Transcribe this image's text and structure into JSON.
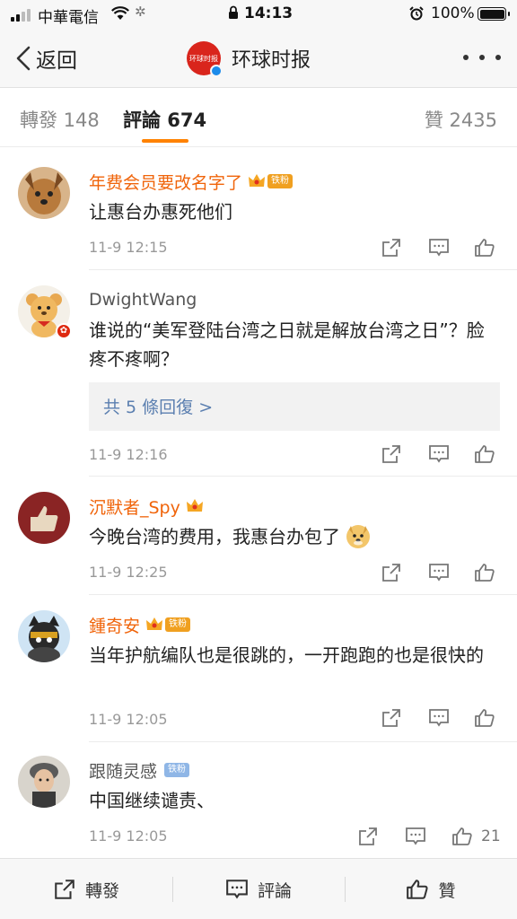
{
  "status_bar": {
    "carrier": "中華電信",
    "time": "14:13",
    "battery": "100%",
    "battery_level": 1.0
  },
  "nav": {
    "back_label": "返回",
    "title": "环球时报",
    "logo_text": "环球时报"
  },
  "tabs": {
    "repost": "轉發 148",
    "comment": "評論 674",
    "like": "贊 2435",
    "active": "comment"
  },
  "colors": {
    "accent": "#ff8200",
    "vip_name": "#f0640a",
    "link": "#5b7fb0"
  },
  "comments": [
    {
      "name": "年费会员要改名字了",
      "badge": "铁粉",
      "vip": true,
      "text": "让惠台办惠死他们",
      "time": "11-9 12:15"
    },
    {
      "name": "DwightWang",
      "text": "谁说的“美军登陆台湾之日就是解放台湾之日”？脸疼不疼啊？",
      "replies": "共 5 條回復 >",
      "time": "11-9 12:16"
    },
    {
      "name": "沉默者_Spy",
      "vip": true,
      "text": "今晚台湾的费用，我惠台办包了",
      "emoji": "doge",
      "time": "11-9 12:25"
    },
    {
      "name": "鍾奇安",
      "badge": "铁粉",
      "vip": true,
      "text": "当年护航编队也是很跳的，一开跑跑的也是很快的",
      "time": "11-9 12:05"
    },
    {
      "name": "跟随灵感",
      "badge": "铁粉",
      "vip": false,
      "text": "中国继续谴责、",
      "time": "11-9 12:05",
      "likes": "21"
    }
  ],
  "toolbar": {
    "repost": "轉發",
    "comment": "評論",
    "like": "贊"
  }
}
